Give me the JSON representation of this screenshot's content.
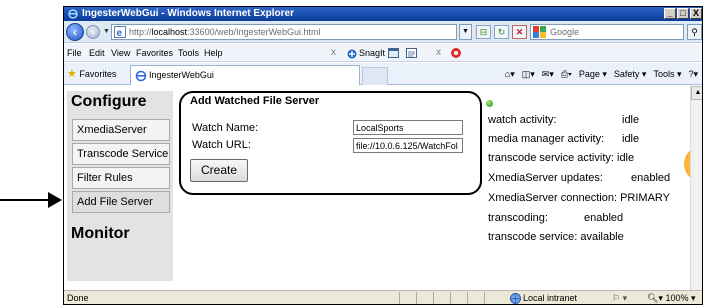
{
  "window": {
    "title": "IngesterWebGui - Windows Internet Explorer",
    "controls": [
      "_",
      "□",
      "X"
    ]
  },
  "address": {
    "url_prefix": "http://",
    "url_host": "localhost",
    "url_path": ":33600/web/IngesterWebGui.html",
    "search_placeholder": "Google"
  },
  "menu": {
    "items": [
      "File",
      "Edit",
      "View",
      "Favorites",
      "Tools",
      "Help"
    ],
    "snagit": "SnagIt"
  },
  "favbar": {
    "favorites": "Favorites",
    "tab_title": "IngesterWebGui",
    "commands": [
      "Page ▾",
      "Safety ▾",
      "Tools ▾"
    ]
  },
  "sidebar": {
    "configure_heading": "Configure",
    "items": [
      "XmediaServer",
      "Transcode Service",
      "Filter Rules",
      "Add File Server"
    ],
    "monitor_heading": "Monitor"
  },
  "panel": {
    "title": "Add Watched File Server",
    "watch_name_label": "Watch Name:",
    "watch_name_value": "LocalSports",
    "watch_url_label": "Watch URL:",
    "watch_url_value": "file://10.0.6.125/WatchFol",
    "create_label": "Create"
  },
  "status": {
    "watch_activity_label": "watch activity:",
    "watch_activity_value": "idle",
    "media_manager_label": "media manager activity:",
    "media_manager_value": "idle",
    "transcode_activity_label": "transcode service activity:",
    "transcode_activity_value": "idle",
    "xms_updates_label": "XmediaServer updates:",
    "xms_updates_value": "enabled",
    "xms_connection_label": "XmediaServer connection:",
    "xms_connection_value": "PRIMARY",
    "transcoding_label": "transcoding:",
    "transcoding_value": "enabled",
    "transcode_service_label": "transcode service:",
    "transcode_service_value": "available"
  },
  "statusbar": {
    "done": "Done",
    "zone": "Local intranet",
    "zoom": "100%"
  },
  "colors": {
    "titlebar": "#0a3a98",
    "sidebar_bg": "#e3e3e3",
    "status_dot": "#1e8a12"
  }
}
